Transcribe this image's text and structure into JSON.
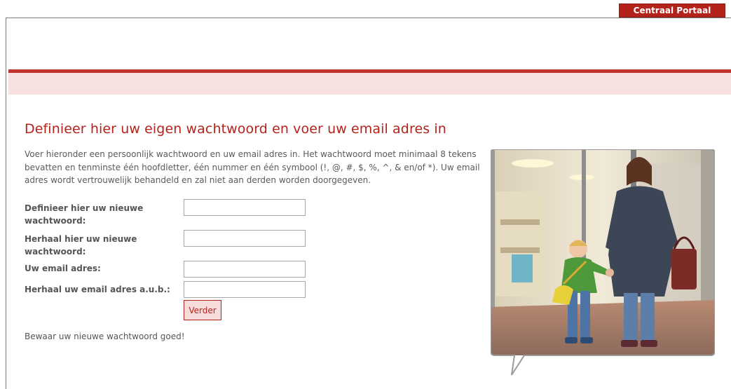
{
  "header": {
    "portal_tab": "Centraal Portaal"
  },
  "main": {
    "title": "Definieer hier uw eigen wachtwoord en voer uw email adres in",
    "intro": "Voer hieronder een persoonlijk wachtwoord en uw email adres in. Het wachtwoord moet minimaal 8 tekens bevatten en tenminste één hoofdletter, één nummer en één symbool (!, @, #, $, %, ^, & en/of *). Uw email adres wordt vertrouwelijk behandeld en zal niet aan derden worden doorgegeven.",
    "form": {
      "new_password_label": "Definieer hier uw nieuwe wachtwoord:",
      "new_password_value": "",
      "repeat_password_label": "Herhaal hier uw nieuwe wachtwoord:",
      "repeat_password_value": "",
      "email_label": "Uw email adres:",
      "email_value": "",
      "repeat_email_label": "Herhaal uw email adres a.u.b.:",
      "repeat_email_value": "",
      "submit_label": "Verder"
    },
    "footer_note": "Bewaar uw nieuwe wachtwoord goed!"
  },
  "colors": {
    "accent": "#b3231c",
    "band": "#c0342c",
    "band_light": "#f7e1e1",
    "button_bg": "#f7dcdc"
  }
}
